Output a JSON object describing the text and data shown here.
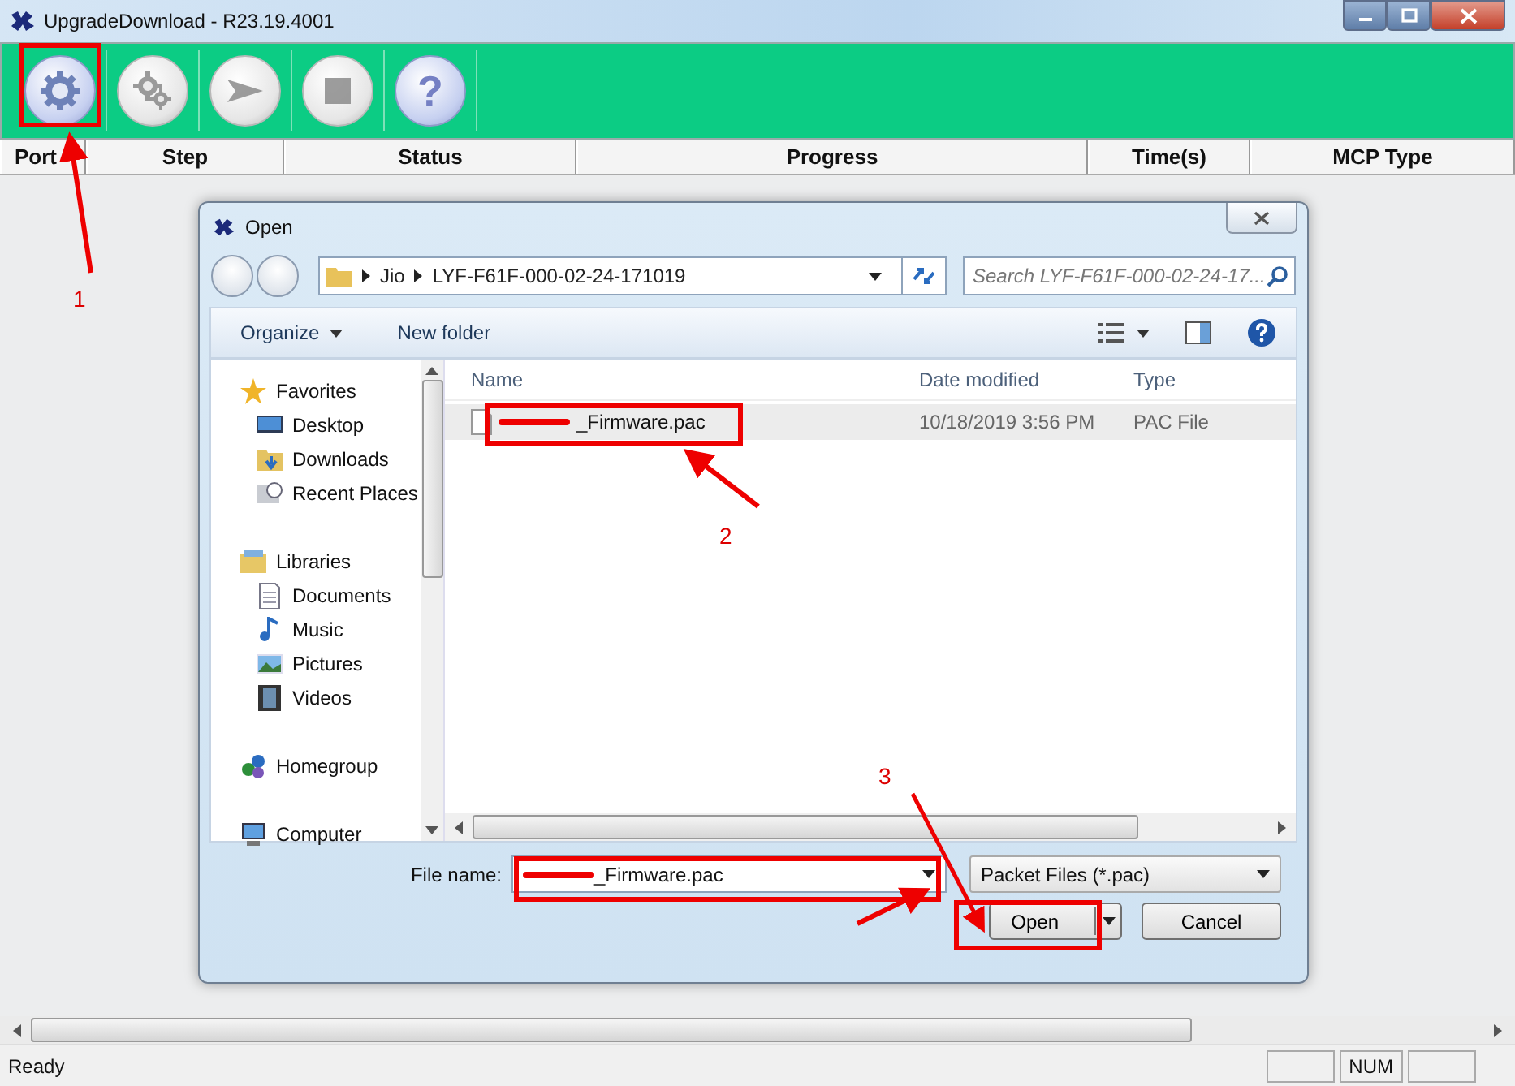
{
  "window": {
    "title": "UpgradeDownload - R23.19.4001"
  },
  "toolbar": {
    "buttons": [
      {
        "kind": "gear",
        "disabled": false
      },
      {
        "kind": "gears",
        "disabled": true
      },
      {
        "kind": "play",
        "disabled": true
      },
      {
        "kind": "stop",
        "disabled": true
      },
      {
        "kind": "help",
        "glyph": "?",
        "disabled": false
      }
    ]
  },
  "table": {
    "columns": [
      "Port",
      "Step",
      "Status",
      "Progress",
      "Time(s)",
      "MCP Type"
    ]
  },
  "dialog": {
    "title": "Open",
    "path": [
      "Jio",
      "LYF-F61F-000-02-24-171019"
    ],
    "search": {
      "placeholder": "Search LYF-F61F-000-02-24-17..."
    },
    "commands": [
      {
        "label": "Organize",
        "dropdown": true
      },
      {
        "label": "New folder",
        "dropdown": false
      }
    ],
    "nav": [
      {
        "label": "Favorites",
        "children": [
          {
            "label": "Desktop"
          },
          {
            "label": "Downloads"
          },
          {
            "label": "Recent Places"
          }
        ]
      },
      {
        "label": "Libraries",
        "children": [
          {
            "label": "Documents"
          },
          {
            "label": "Music"
          },
          {
            "label": "Pictures"
          },
          {
            "label": "Videos"
          }
        ]
      },
      {
        "label": "Homegroup"
      },
      {
        "label": "Computer"
      }
    ],
    "file_columns": [
      "Name",
      "Date modified",
      "Type"
    ],
    "files": [
      {
        "name": "_Firmware.pac",
        "redacted": true,
        "date": "10/18/2019 3:56 PM",
        "type": "PAC File",
        "selected": true
      }
    ],
    "file_name": {
      "label": "File name:",
      "value": "_Firmware.pac",
      "redacted": true
    },
    "filter": "Packet Files (*.pac)",
    "buttons": [
      {
        "label": "Open",
        "split": true
      },
      {
        "label": "Cancel",
        "split": false
      }
    ]
  },
  "status_bar": {
    "text": "Ready",
    "indicators": [
      "NUM"
    ]
  },
  "annotations": {
    "step_numbers": [
      "1",
      "2",
      "3"
    ]
  }
}
